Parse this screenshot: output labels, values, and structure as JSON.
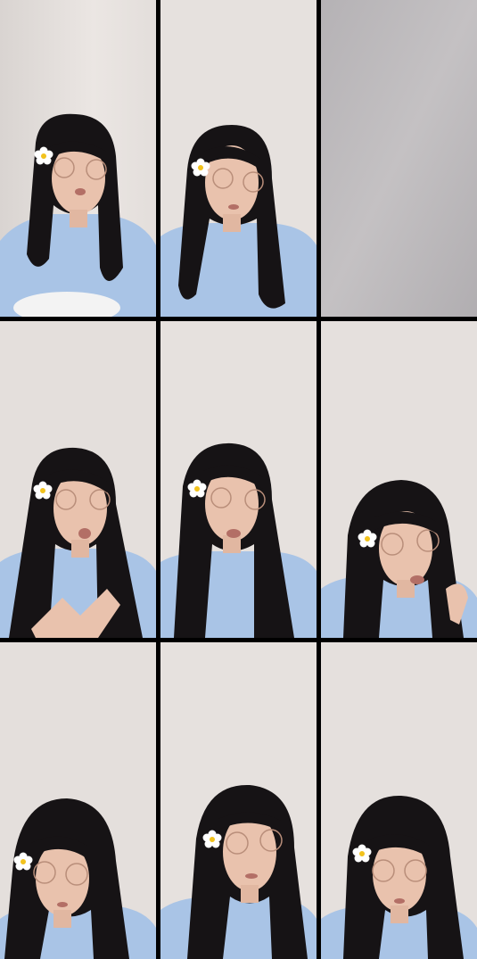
{
  "layout": {
    "rows": 3,
    "cols": 3
  },
  "colors": {
    "divider": "#000000",
    "wall": "#e6e1de",
    "wall_shadow": "#cfcac7",
    "gray_panel": "#b9b6b9",
    "shirt": "#a9c4e6",
    "hair": "#161315",
    "skin": "#e9c2ad",
    "flower_petal": "#ffffff",
    "flower_center": "#f2c21c"
  },
  "cells": [
    {
      "id": "r1c1",
      "content": "person",
      "flower": true
    },
    {
      "id": "r1c2",
      "content": "person",
      "flower": true
    },
    {
      "id": "r1c3",
      "content": "blank-gray"
    },
    {
      "id": "r2c1",
      "content": "person",
      "flower": true
    },
    {
      "id": "r2c2",
      "content": "person",
      "flower": true
    },
    {
      "id": "r2c3",
      "content": "person",
      "flower": true
    },
    {
      "id": "r3c1",
      "content": "person",
      "flower": true
    },
    {
      "id": "r3c2",
      "content": "person",
      "flower": true
    },
    {
      "id": "r3c3",
      "content": "person",
      "flower": true
    }
  ]
}
